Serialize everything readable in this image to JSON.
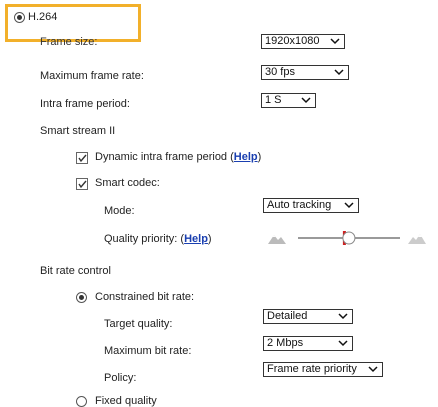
{
  "codec": {
    "label": "H.264",
    "selected": true
  },
  "fields": {
    "frame_size": {
      "label": "Frame size:",
      "value": "1920x1080"
    },
    "max_frame_rate": {
      "label": "Maximum frame rate:",
      "value": "30 fps"
    },
    "intra_frame_period": {
      "label": "Intra frame period:",
      "value": "1 S"
    }
  },
  "smart_stream": {
    "title": "Smart stream II",
    "dynamic_intra": {
      "label": "Dynamic intra frame period (",
      "help": "Help",
      "close": ")",
      "checked": true
    },
    "smart_codec": {
      "label": "Smart codec:",
      "checked": true
    },
    "mode": {
      "label": "Mode:",
      "value": "Auto tracking"
    },
    "quality_priority": {
      "label": "Quality priority: (",
      "help": "Help",
      "close": ")",
      "slider_level": 0.45
    }
  },
  "bit_rate_control": {
    "title": "Bit rate control",
    "constrained": {
      "label": "Constrained bit rate:",
      "selected": true
    },
    "target_quality": {
      "label": "Target quality:",
      "value": "Detailed"
    },
    "max_bit_rate": {
      "label": "Maximum bit rate:",
      "value": "2 Mbps"
    },
    "policy": {
      "label": "Policy:",
      "value": "Frame rate priority"
    },
    "fixed_quality": {
      "label": "Fixed quality",
      "selected": false
    }
  },
  "colors": {
    "highlight": "#f2b02a",
    "slider_knob": "#cc2222",
    "link": "#1a3fb0"
  }
}
